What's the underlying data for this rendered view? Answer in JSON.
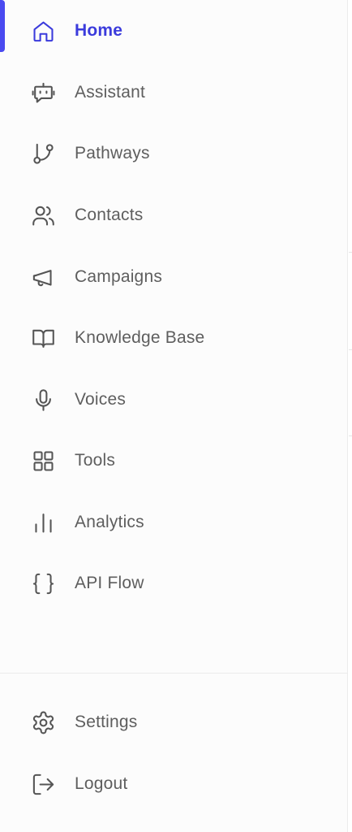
{
  "sidebar": {
    "active_item": "Home",
    "items": [
      {
        "label": "Home",
        "icon": "home-icon"
      },
      {
        "label": "Assistant",
        "icon": "bot-icon"
      },
      {
        "label": "Pathways",
        "icon": "git-branch-icon"
      },
      {
        "label": "Contacts",
        "icon": "users-icon"
      },
      {
        "label": "Campaigns",
        "icon": "megaphone-icon"
      },
      {
        "label": "Knowledge Base",
        "icon": "book-open-icon"
      },
      {
        "label": "Voices",
        "icon": "microphone-icon"
      },
      {
        "label": "Tools",
        "icon": "grid-icon"
      },
      {
        "label": "Analytics",
        "icon": "bar-chart-icon"
      },
      {
        "label": "API Flow",
        "icon": "braces-icon"
      }
    ],
    "footer_items": [
      {
        "label": "Settings",
        "icon": "gear-icon"
      },
      {
        "label": "Logout",
        "icon": "logout-icon"
      }
    ]
  },
  "colors": {
    "accent": "#3b3bdc",
    "indicator": "#4a4af0",
    "text": "#5e5e5e",
    "icon": "#555555",
    "sidebar_bg": "#fcfcfc"
  }
}
